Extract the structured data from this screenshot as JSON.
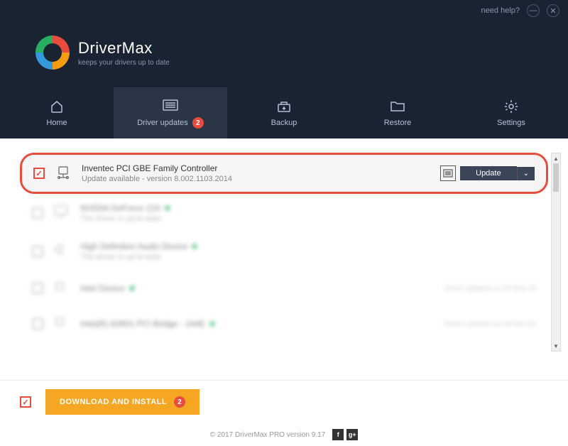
{
  "topbar": {
    "help": "need help?"
  },
  "brand": {
    "title": "DriverMax",
    "subtitle": "keeps your drivers up to date"
  },
  "nav": {
    "items": [
      {
        "label": "Home"
      },
      {
        "label": "Driver updates",
        "badge": "2",
        "active": true
      },
      {
        "label": "Backup"
      },
      {
        "label": "Restore"
      },
      {
        "label": "Settings"
      }
    ]
  },
  "devices": {
    "highlighted": {
      "name": "Inventec PCI GBE Family Controller",
      "status": "Update available - version 8.002.1103.2014",
      "button": "Update"
    },
    "blurred": [
      {
        "name": "NVIDIA GeForce 210",
        "status": "The driver is up-to-date"
      },
      {
        "name": "High Definition Audio Device",
        "status": "The driver is up-to-date"
      },
      {
        "name": "Intel Device",
        "status": "",
        "side": "Driver updated on 03-Nov-16"
      },
      {
        "name": "Intel(R) 82801 PCI Bridge - 244E",
        "status": "",
        "side": "Driver updated on 03-Nov-16"
      }
    ]
  },
  "footer": {
    "download": "DOWNLOAD AND INSTALL",
    "download_badge": "2"
  },
  "bottom": {
    "copyright": "© 2017 DriverMax PRO version 9.17"
  }
}
